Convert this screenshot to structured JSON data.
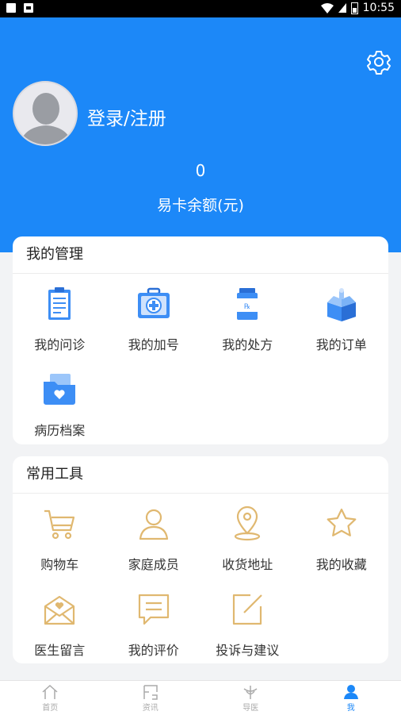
{
  "status_bar": {
    "time": "10:55"
  },
  "profile": {
    "login_label": "登录/注册",
    "balance_value": "0",
    "balance_label": "易卡余额(元)"
  },
  "management": {
    "title": "我的管理",
    "items": [
      {
        "label": "我的问诊",
        "icon": "clipboard-icon"
      },
      {
        "label": "我的加号",
        "icon": "medical-kit-icon"
      },
      {
        "label": "我的处方",
        "icon": "prescription-bottle-icon"
      },
      {
        "label": "我的订单",
        "icon": "open-box-icon"
      },
      {
        "label": "病历档案",
        "icon": "medical-folder-icon"
      }
    ]
  },
  "tools": {
    "title": "常用工具",
    "items": [
      {
        "label": "购物车",
        "icon": "cart-icon"
      },
      {
        "label": "家庭成员",
        "icon": "user-icon"
      },
      {
        "label": "收货地址",
        "icon": "location-icon"
      },
      {
        "label": "我的收藏",
        "icon": "star-icon"
      },
      {
        "label": "医生留言",
        "icon": "envelope-icon"
      },
      {
        "label": "我的评价",
        "icon": "comment-icon"
      },
      {
        "label": "投诉与建议",
        "icon": "edit-icon"
      }
    ]
  },
  "tabbar": [
    {
      "label": "首页",
      "icon": "home-icon"
    },
    {
      "label": "资讯",
      "icon": "news-icon"
    },
    {
      "label": "导医",
      "icon": "guide-icon"
    },
    {
      "label": "我",
      "icon": "profile-icon",
      "active": true
    }
  ],
  "colors": {
    "primary": "#1c88f8",
    "tool_icon": "#e0b870",
    "background": "#f2f3f5"
  }
}
